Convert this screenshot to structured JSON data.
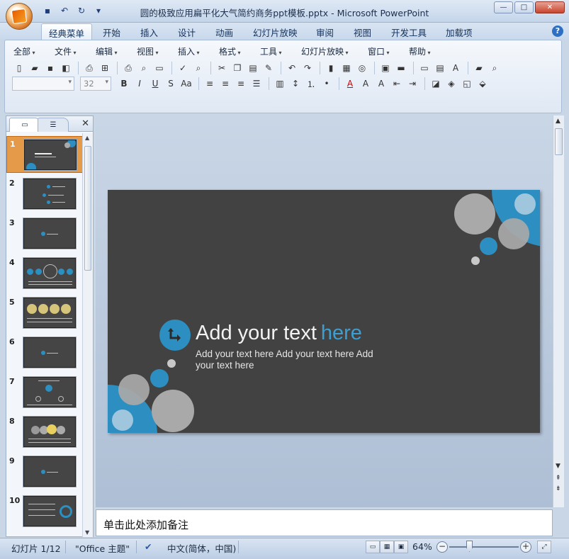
{
  "window": {
    "title": "圆的极致应用扁平化大气简约商务ppt模板.pptx - Microsoft PowerPoint",
    "controls": [
      "—",
      "□",
      "✕"
    ]
  },
  "ribbon_tabs": [
    {
      "label": "经典菜单",
      "active": true
    },
    {
      "label": "开始"
    },
    {
      "label": "插入"
    },
    {
      "label": "设计"
    },
    {
      "label": "动画"
    },
    {
      "label": "幻灯片放映"
    },
    {
      "label": "审阅"
    },
    {
      "label": "视图"
    },
    {
      "label": "开发工具"
    },
    {
      "label": "加载项"
    }
  ],
  "menus": [
    "全部",
    "文件",
    "编辑",
    "视图",
    "插入",
    "格式",
    "工具",
    "幻灯片放映",
    "窗口",
    "帮助"
  ],
  "format_bar": {
    "font_name": "",
    "font_size": "32"
  },
  "slides_panel": {
    "numbers": [
      "1",
      "2",
      "3",
      "4",
      "5",
      "6",
      "7",
      "8",
      "9",
      "10"
    ],
    "selected": "1"
  },
  "slide": {
    "title_main": "Add your text",
    "title_highlight": "here",
    "subtitle": "Add your text here Add your text here Add your text here",
    "colors": {
      "background": "#424242",
      "accent": "#2d8fc1",
      "circle_grey": "#a8a8a8"
    }
  },
  "notes_placeholder": "单击此处添加备注",
  "status": {
    "slide_counter": "幻灯片 1/12",
    "theme": "\"Office 主题\"",
    "language": "中文(简体，中国)",
    "zoom": "64%"
  }
}
